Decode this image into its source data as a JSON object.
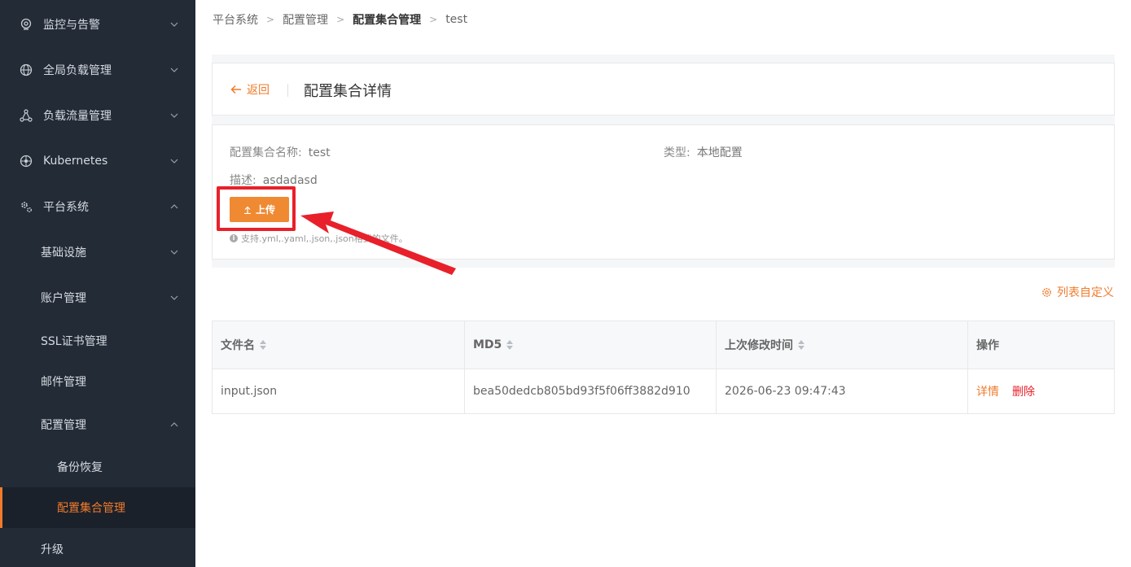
{
  "sidebar": {
    "items": [
      {
        "label": "监控与告警",
        "icon": "location-pin-icon",
        "expanded": false
      },
      {
        "label": "全局负载管理",
        "icon": "globe-icon",
        "expanded": false
      },
      {
        "label": "负载流量管理",
        "icon": "network-nodes-icon",
        "expanded": false
      },
      {
        "label": "Kubernetes",
        "icon": "kubernetes-helm-icon",
        "expanded": false
      },
      {
        "label": "平台系统",
        "icon": "gears-icon",
        "expanded": true
      },
      {
        "label": "基础设施",
        "expanded": false
      },
      {
        "label": "账户管理",
        "expanded": false
      },
      {
        "label": "SSL证书管理"
      },
      {
        "label": "邮件管理"
      },
      {
        "label": "配置管理",
        "expanded": true
      },
      {
        "label": "备份恢复"
      },
      {
        "label": "配置集合管理",
        "active": true
      },
      {
        "label": "升级"
      }
    ]
  },
  "breadcrumb": [
    "平台系统",
    "配置管理",
    "配置集合管理",
    "test"
  ],
  "header": {
    "back_label": "返回",
    "title": "配置集合详情"
  },
  "info": {
    "name_label": "配置集合名称:",
    "name_value": "test",
    "type_label": "类型:",
    "type_value": "本地配置",
    "desc_label": "描述:",
    "desc_value": "asdadasd",
    "upload_label": "上传",
    "hint": "支持.yml,.yaml,.json,.json格式的文件。"
  },
  "toolbar": {
    "customize_label": "列表自定义"
  },
  "table": {
    "columns": [
      "文件名",
      "MD5",
      "上次修改时间",
      "操作"
    ],
    "rows": [
      {
        "filename": "input.json",
        "md5": "bea50dedcb805bd93f5f06ff3882d910",
        "modified": "2026-06-23 09:47:43",
        "detail": "详情",
        "delete": "删除"
      }
    ]
  },
  "colors": {
    "accent": "#ef7b2c",
    "danger": "#e8202a",
    "sidebar_bg": "#232b37"
  }
}
